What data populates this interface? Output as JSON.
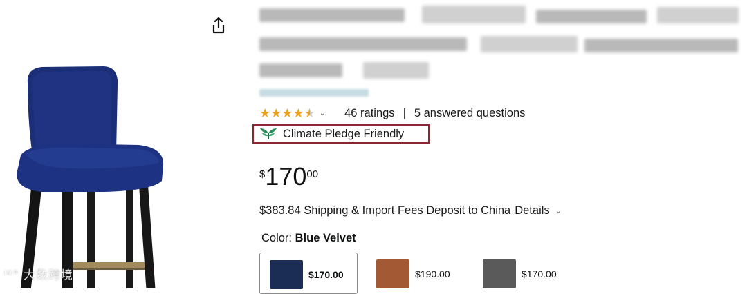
{
  "rating": {
    "stars": 4.5,
    "ratings_text": "46 ratings",
    "separator": "|",
    "questions_text": "5 answered questions"
  },
  "badge": {
    "label": "Climate Pledge Friendly",
    "accent": "#8b2632",
    "icon": "leaf-pledge-icon"
  },
  "price": {
    "currency": "$",
    "whole": "170",
    "fraction": "00"
  },
  "shipping": {
    "text": "$383.84 Shipping & Import Fees Deposit to China",
    "details_label": "Details"
  },
  "color": {
    "label": "Color:",
    "selected": "Blue Velvet"
  },
  "swatches": [
    {
      "price": "$170.00",
      "color": "#1b2d55",
      "selected": true
    },
    {
      "price": "$190.00",
      "color": "#a35a34",
      "selected": false
    },
    {
      "price": "$170.00",
      "color": "#5a5a5a",
      "selected": false
    }
  ],
  "watermark": "大数跨境",
  "colors": {
    "star": "#e9a21b",
    "chair": "#1b2f78",
    "legs": "#1a1a1a"
  }
}
